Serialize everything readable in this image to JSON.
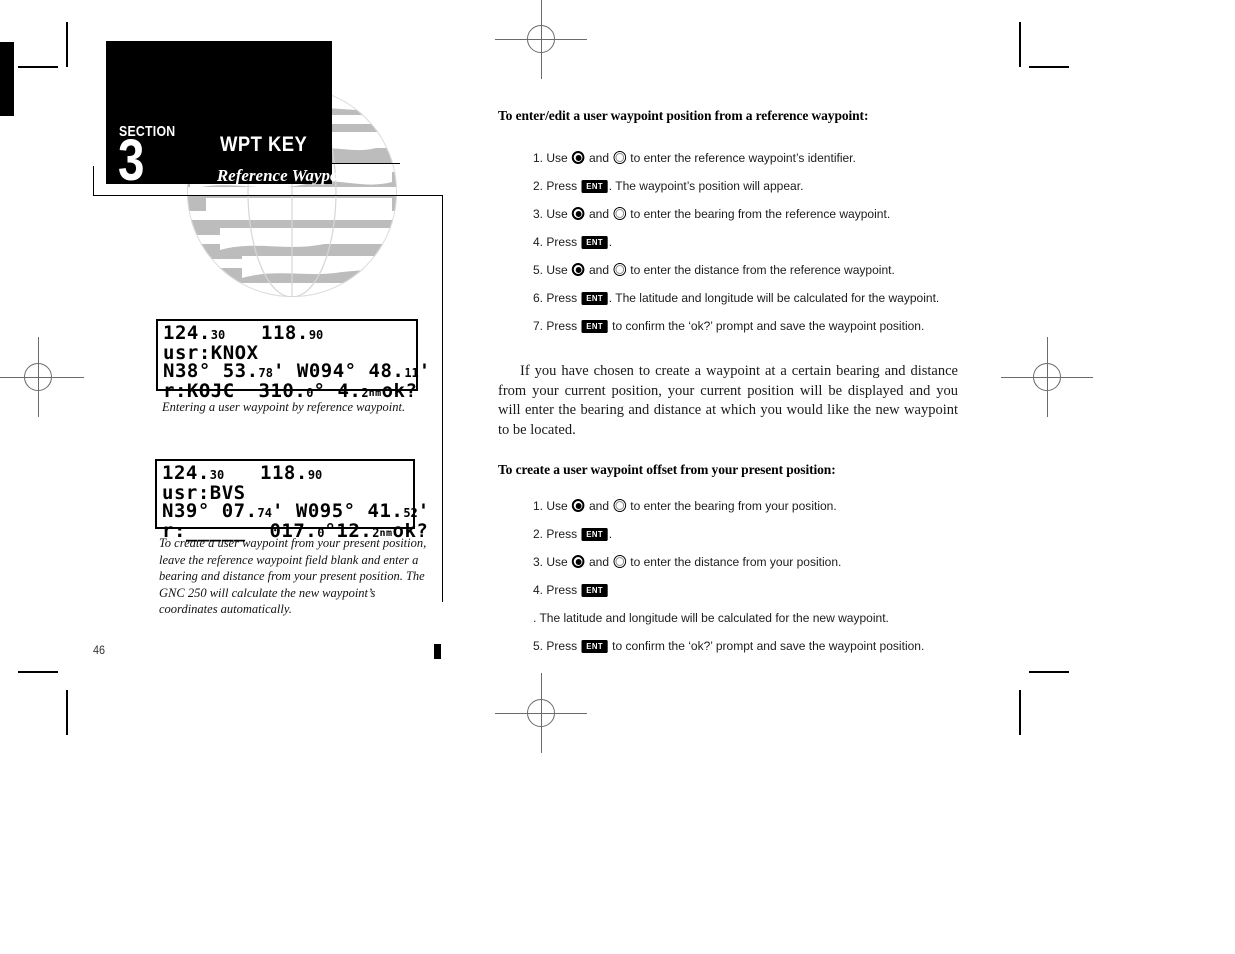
{
  "header": {
    "section_label": "SECTION",
    "section_number": "3",
    "title": "WPT KEY",
    "subtitle": "Reference Waypoints"
  },
  "page_number": "46",
  "screens": [
    {
      "name": "reference-waypoint-screen",
      "line1_left": "124.",
      "line1_left_sm": "30",
      "line1_right": "118.",
      "line1_right_sm": "90",
      "line2": "usr:KNOX",
      "line3_lat": "N38° 53.",
      "line3_lat_sm": "78",
      "line3_lat_tick": "'",
      "line3_lon": "W094° 48.",
      "line3_lon_sm": "11",
      "line3_lon_tick": "'",
      "line4_ref": "r:KOJC",
      "line4_brg": "310.",
      "line4_brg_sm": "0",
      "line4_brg_deg": "°",
      "line4_dst": "4.",
      "line4_dst_sm": "2",
      "line4_unit": "nm",
      "line4_ok": "ok?",
      "caption": "Entering a user waypoint by reference waypoint."
    },
    {
      "name": "present-position-offset-screen",
      "line1_left": "124.",
      "line1_left_sm": "30",
      "line1_right": "118.",
      "line1_right_sm": "90",
      "line2": "usr:BVS",
      "line3_lat": "N39° 07.",
      "line3_lat_sm": "74",
      "line3_lat_tick": "'",
      "line3_lon": "W095° 41.",
      "line3_lon_sm": "52",
      "line3_lon_tick": "'",
      "line4_ref": "r:_____",
      "line4_brg": "017.",
      "line4_brg_sm": "0",
      "line4_brg_deg": "°",
      "line4_dst": "12.",
      "line4_dst_sm": "2",
      "line4_unit": "nm",
      "line4_ok": "ok?",
      "caption": "To create a user waypoint from your present position, leave the reference waypoint field blank and enter a bearing and distance from your present position. The GNC 250 will calculate the new waypoint’s coordinates automatically."
    }
  ],
  "main": {
    "heading1": "To enter/edit a user waypoint position from a reference waypoint:",
    "steps1": [
      {
        "num": "1.",
        "pre": "Use ",
        "mid": " and ",
        "post": " to enter the reference waypoint’s identifier.",
        "icons": "knobs"
      },
      {
        "num": "2.",
        "pre": "Press ",
        "post": ". The waypoint’s position will appear.",
        "icons": "ent",
        "key": "ENT"
      },
      {
        "num": "3.",
        "pre": "Use ",
        "mid": " and ",
        "post": " to enter the bearing from the reference waypoint.",
        "icons": "knobs"
      },
      {
        "num": "4.",
        "pre": "Press ",
        "post": ".",
        "icons": "ent",
        "key": "ENT"
      },
      {
        "num": "5.",
        "pre": "Use ",
        "mid": " and ",
        "post": " to enter the distance from the reference waypoint.",
        "icons": "knobs"
      },
      {
        "num": "6.",
        "pre": "Press ",
        "post": ". The latitude and longitude will be calculated for the waypoint.",
        "icons": "ent",
        "key": "ENT"
      },
      {
        "num": "7.",
        "pre": "Press ",
        "post": " to confirm the ‘ok?’ prompt and save the waypoint position.",
        "icons": "ent",
        "key": "ENT"
      }
    ],
    "paragraph": "If you have chosen to create a waypoint at a certain bearing and distance from your current position, your current position will be displayed and you will enter the bearing and distance at which you would like the new waypoint to be located.",
    "heading2": "To create a user waypoint offset from your present position:",
    "steps2": [
      {
        "num": "1.",
        "pre": "Use ",
        "mid": " and ",
        "post": " to enter the bearing from your position.",
        "icons": "knobs"
      },
      {
        "num": "2.",
        "pre": "Press ",
        "post": ".",
        "icons": "ent",
        "key": "ENT"
      },
      {
        "num": "3.",
        "pre": "Use ",
        "mid": " and ",
        "post": " to enter the distance from your position.",
        "icons": "knobs"
      },
      {
        "num": "4.",
        "pre": "Press ",
        "post": ". The latitude and longitude will be calculated for the new waypoint.",
        "icons": "ent",
        "key": "ENT"
      },
      {
        "num": "5.",
        "pre": "Press ",
        "post": " to confirm the ‘ok?’ prompt and save the waypoint position.",
        "icons": "ent",
        "key": "ENT"
      }
    ]
  },
  "colors": {
    "ink": "#000000",
    "watermark_gray": "#bcbcbc",
    "reg_mark_gray": "#6b6b6b"
  }
}
